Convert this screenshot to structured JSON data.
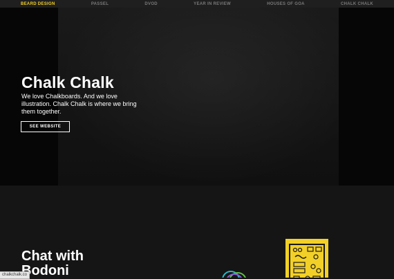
{
  "nav": {
    "items": [
      {
        "label": "BEARD DESIGN",
        "active": true
      },
      {
        "label": "PASSEL",
        "active": false
      },
      {
        "label": "DVOD",
        "active": false
      },
      {
        "label": "YEAR IN REVIEW",
        "active": false
      },
      {
        "label": "HOUSES OF GOA",
        "active": false
      },
      {
        "label": "CHALK CHALK",
        "active": false
      }
    ]
  },
  "hero": {
    "title": "Chalk Chalk",
    "description": "We love Chalkboards. And we love illustration. Chalk Chalk is where we bring them together.",
    "button_label": "SEE WEBSITE"
  },
  "section2": {
    "title": "Chat with Bodoni"
  },
  "status": {
    "url": "chalkchalk.co"
  },
  "colors": {
    "accent": "#f2d027",
    "background": "#141414"
  }
}
